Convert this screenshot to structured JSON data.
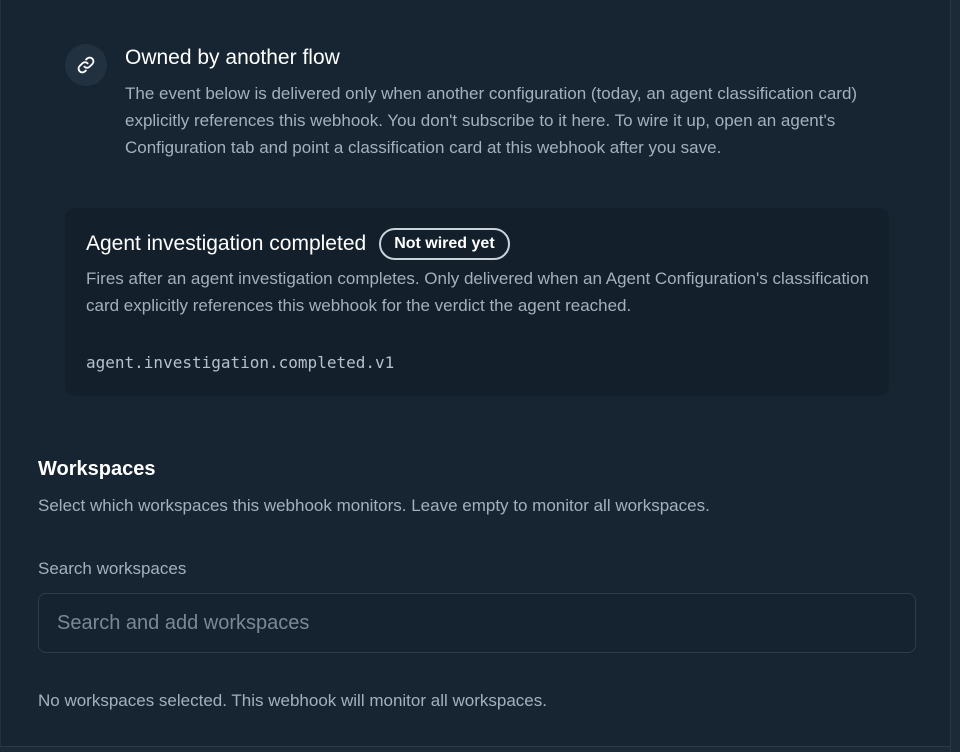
{
  "owned_flow": {
    "icon": "link-icon",
    "title": "Owned by another flow",
    "description": "The event below is delivered only when another configuration (today, an agent classification card) explicitly references this webhook. You don't subscribe to it here. To wire it up, open an agent's Configuration tab and point a classification card at this webhook after you save."
  },
  "event": {
    "title": "Agent investigation completed",
    "badge": "Not wired yet",
    "description": "Fires after an agent investigation completes. Only delivered when an Agent Configuration's classification card explicitly references this webhook for the verdict the agent reached.",
    "code": "agent.investigation.completed.v1"
  },
  "workspaces": {
    "title": "Workspaces",
    "description": "Select which workspaces this webhook monitors. Leave empty to monitor all workspaces.",
    "search_label": "Search workspaces",
    "search_placeholder": "Search and add workspaces",
    "search_value": "",
    "empty_message": "No workspaces selected. This webhook will monitor all workspaces."
  },
  "colors": {
    "background": "#172532",
    "card": "#131f2a",
    "text_primary": "#ffffff",
    "text_secondary": "#a3b0bd"
  }
}
